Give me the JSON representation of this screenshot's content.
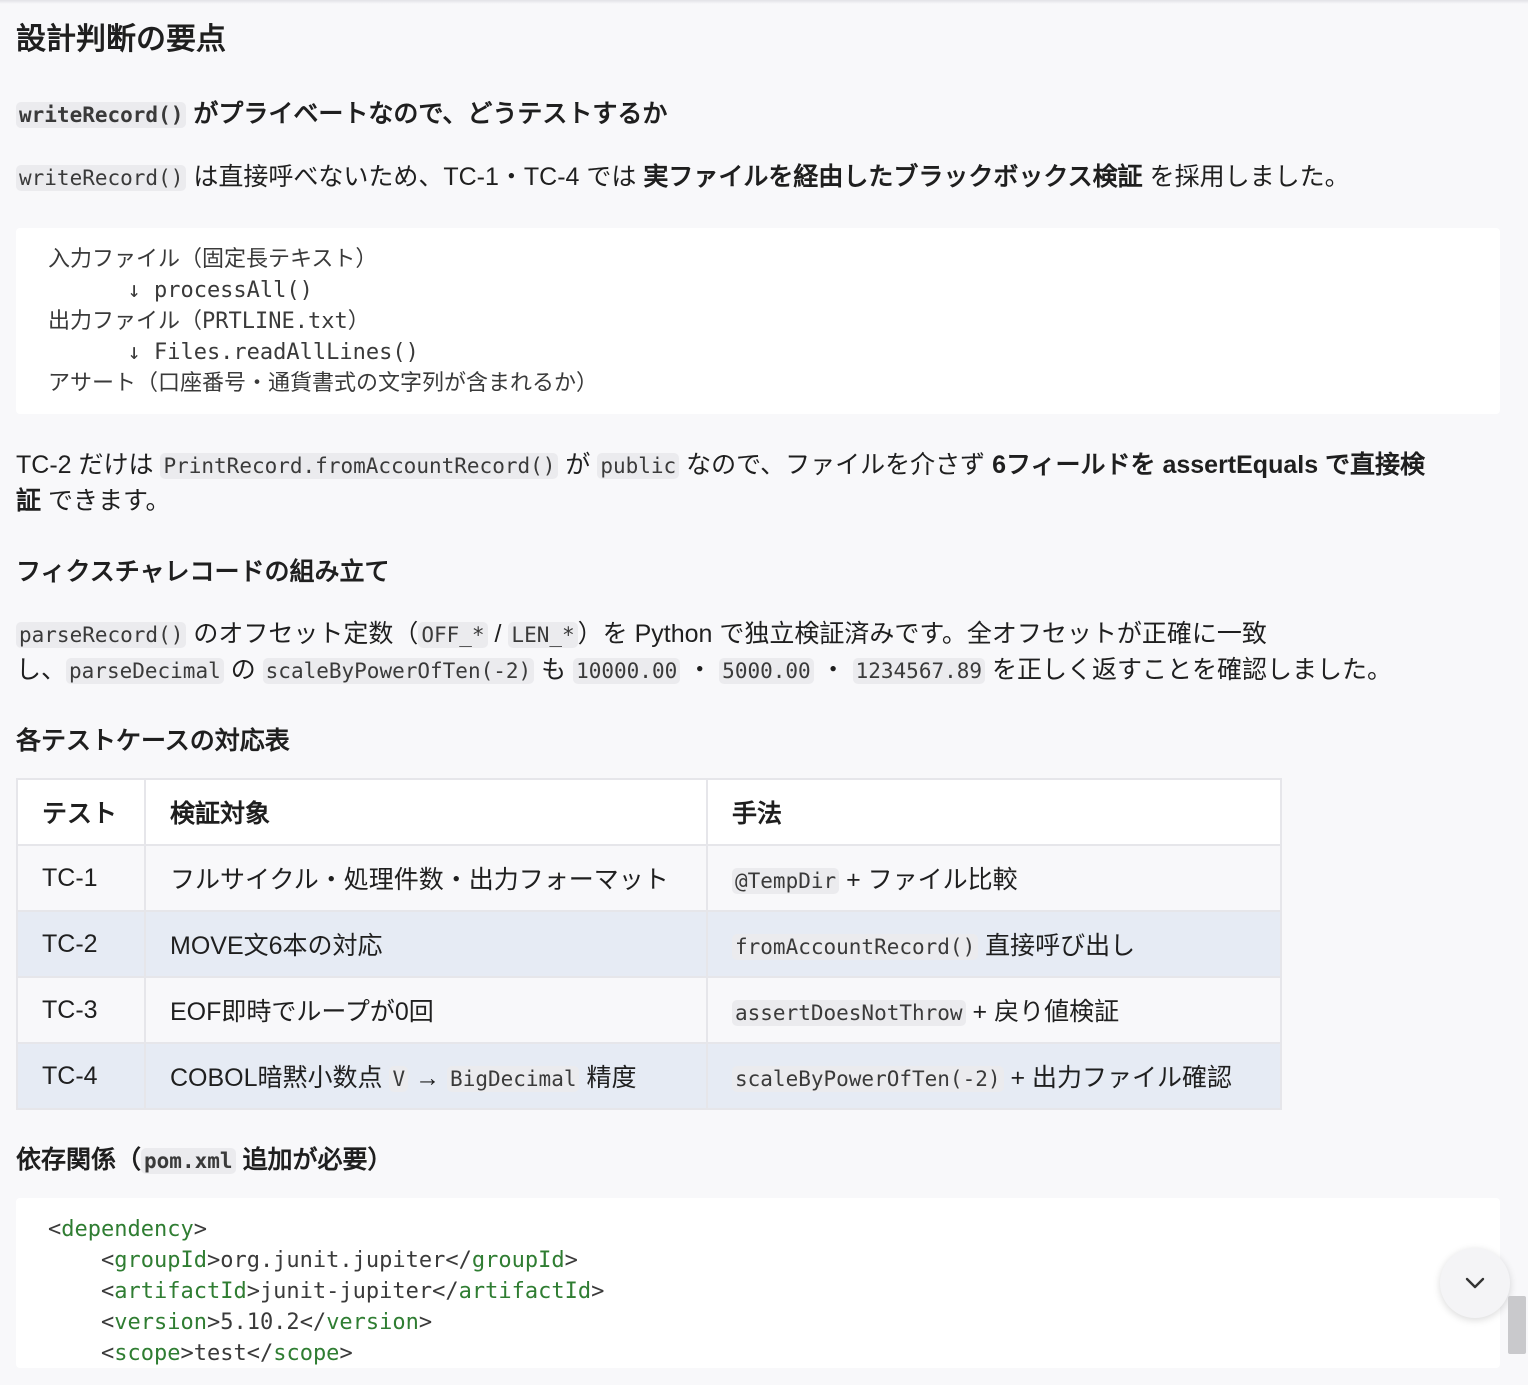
{
  "heading": "設計判断の要点",
  "sec1": {
    "title_code": "writeRecord()",
    "title_text": "がプライベートなので、どうテストするか",
    "p_code": "writeRecord()",
    "p_text1": "は直接呼べないため、TC-1・TC-4 では",
    "p_bold": "実ファイルを経由したブラックボックス検証",
    "p_text2": "を採用しました。"
  },
  "flow_lines": [
    "入力ファイル（固定長テキスト）",
    "      ↓ processAll()",
    "出力ファイル（PRTLINE.txt）",
    "      ↓ Files.readAllLines()",
    "アサート（口座番号・通貨書式の文字列が含まれるか）"
  ],
  "tc2": {
    "t1": "TC-2 だけは",
    "c1": "PrintRecord.fromAccountRecord()",
    "t2": "が",
    "c2": "public",
    "t3": "なので、ファイルを介さず",
    "bold1": "6フィールドを assertEquals で直接検",
    "bold2": "証",
    "t4": "できます。"
  },
  "sec2": {
    "title": "フィクスチャレコードの組み立て",
    "c1": "parseRecord()",
    "t1": "のオフセット定数（",
    "c2": "OFF_*",
    "t2": "/",
    "c3": "LEN_*",
    "t3": "）を Python で独立検証済みです。全オフセットが正確に一致",
    "t4": "し、",
    "c4": "parseDecimal",
    "t5": "の",
    "c5": "scaleByPowerOfTen(-2)",
    "t6": "も",
    "c6": "10000.00",
    "t7": "・",
    "c7": "5000.00",
    "t8": "・",
    "c8": "1234567.89",
    "t9": "を正しく返すことを確認しました。"
  },
  "sec3": {
    "title": "各テストケースの対応表",
    "headers": [
      "テスト",
      "検証対象",
      "手法"
    ],
    "rows": [
      {
        "id": "TC-1",
        "target": "フルサイクル・処理件数・出力フォーマット",
        "m_code": "@TempDir",
        "m_text": "+ ファイル比較"
      },
      {
        "id": "TC-2",
        "target": "MOVE文6本の対応",
        "m_code": "fromAccountRecord()",
        "m_text": "直接呼び出し"
      },
      {
        "id": "TC-3",
        "target": "EOF即時でループが0回",
        "m_code": "assertDoesNotThrow",
        "m_text": "+ 戻り値検証"
      },
      {
        "id": "TC-4",
        "target_t1": "COBOL暗黙小数点",
        "target_c1": "V",
        "target_t2": "→",
        "target_c2": "BigDecimal",
        "target_t3": "精度",
        "m_code": "scaleByPowerOfTen(-2)",
        "m_text": "+ 出力ファイル確認"
      }
    ]
  },
  "sec4": {
    "title_t1": "依存関係（",
    "title_code": "pom.xml",
    "title_t2": "追加が必要）"
  },
  "xml": {
    "dependency": "dependency",
    "groupId": "groupId",
    "groupId_val": "org.junit.jupiter",
    "artifactId": "artifactId",
    "artifactId_val": "junit-jupiter",
    "version": "version",
    "version_val": "5.10.2",
    "scope": "scope",
    "scope_val": "test"
  },
  "scroll_down_icon": "chevron-down-icon"
}
